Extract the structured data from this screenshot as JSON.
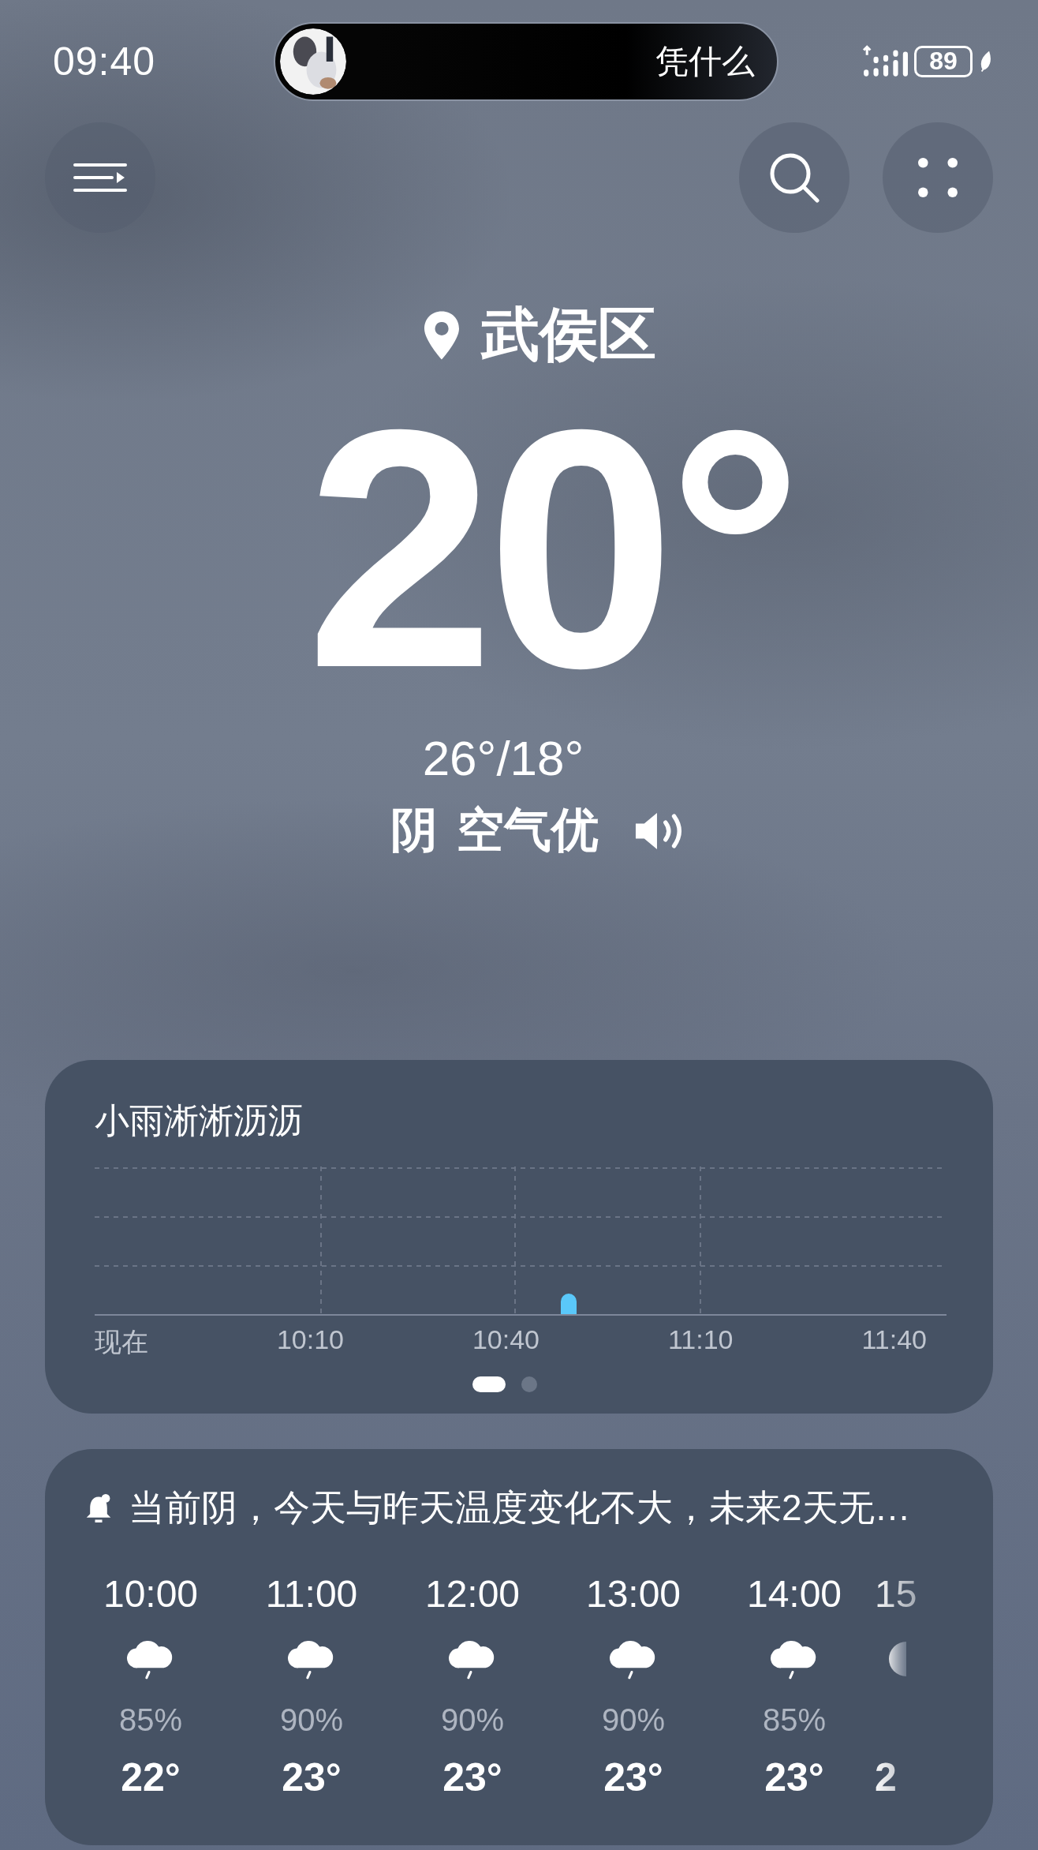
{
  "status_bar": {
    "time": "09:40",
    "now_playing": {
      "title": "凭什么"
    },
    "battery": "89"
  },
  "header": {
    "location": "武侯区"
  },
  "current": {
    "temperature": "20°",
    "high_low": "26°/18°",
    "condition": "阴",
    "air_quality": "空气优"
  },
  "precipitation": {
    "title": "小雨淅淅沥沥",
    "axis_labels": [
      "现在",
      "10:10",
      "10:40",
      "11:10",
      "11:40"
    ],
    "pages": [
      {
        "selected": true
      },
      {
        "selected": false
      }
    ]
  },
  "forecast": {
    "summary": "当前阴，今天与昨天温度变化不大，未来2天无…",
    "hours": [
      {
        "time": "10:00",
        "kind": "rain",
        "humidity": "85%",
        "temp": "22°"
      },
      {
        "time": "11:00",
        "kind": "rain",
        "humidity": "90%",
        "temp": "23°"
      },
      {
        "time": "12:00",
        "kind": "rain",
        "humidity": "90%",
        "temp": "23°"
      },
      {
        "time": "13:00",
        "kind": "rain",
        "humidity": "90%",
        "temp": "23°"
      },
      {
        "time": "14:00",
        "kind": "rain",
        "humidity": "85%",
        "temp": "23°"
      },
      {
        "time": "15",
        "kind": "moon",
        "temp": "2"
      }
    ]
  }
}
